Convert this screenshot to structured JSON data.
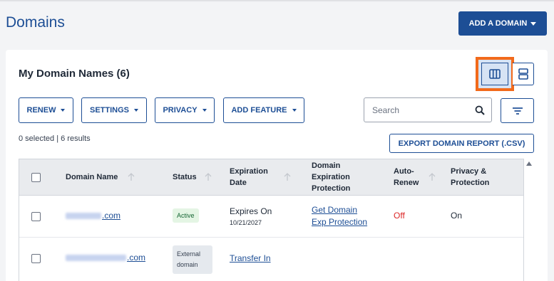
{
  "header": {
    "title": "Domains",
    "add_domain_label": "ADD A DOMAIN"
  },
  "card": {
    "title": "My Domain Names (6)"
  },
  "toolbar": {
    "renew_label": "RENEW",
    "settings_label": "SETTINGS",
    "privacy_label": "PRIVACY",
    "add_feature_label": "ADD FEATURE",
    "search_placeholder": "Search",
    "export_label": "EXPORT DOMAIN REPORT (.CSV)"
  },
  "selection": {
    "summary": "0 selected | 6 results"
  },
  "table": {
    "columns": {
      "domain": "Domain Name",
      "status": "Status",
      "expiration_1": "Expiration",
      "expiration_2": "Date",
      "protection_1": "Domain",
      "protection_2": "Expiration",
      "protection_3": "Protection",
      "autorenew_1": "Auto-",
      "autorenew_2": "Renew",
      "privacy_1": "Privacy &",
      "privacy_2": "Protection"
    },
    "rows": [
      {
        "domain_suffix": ".com",
        "status": "Active",
        "expires_label": "Expires On",
        "expires_date": "10/21/2027",
        "protection_link_1": "Get Domain",
        "protection_link_2": "Exp Protection",
        "auto_renew": "Off",
        "privacy": "On"
      },
      {
        "domain_suffix": ".com",
        "status_1": "External",
        "status_2": "domain",
        "expiration_link": "Transfer In"
      }
    ]
  },
  "colors": {
    "brand": "#1d4e95",
    "highlight": "#f26a1b",
    "off": "#dc2626"
  },
  "icons": [
    "chevron-down-icon",
    "column-view-icon",
    "row-view-icon",
    "search-icon",
    "filter-icon",
    "sort-arrow-icon",
    "scroll-up-icon"
  ]
}
